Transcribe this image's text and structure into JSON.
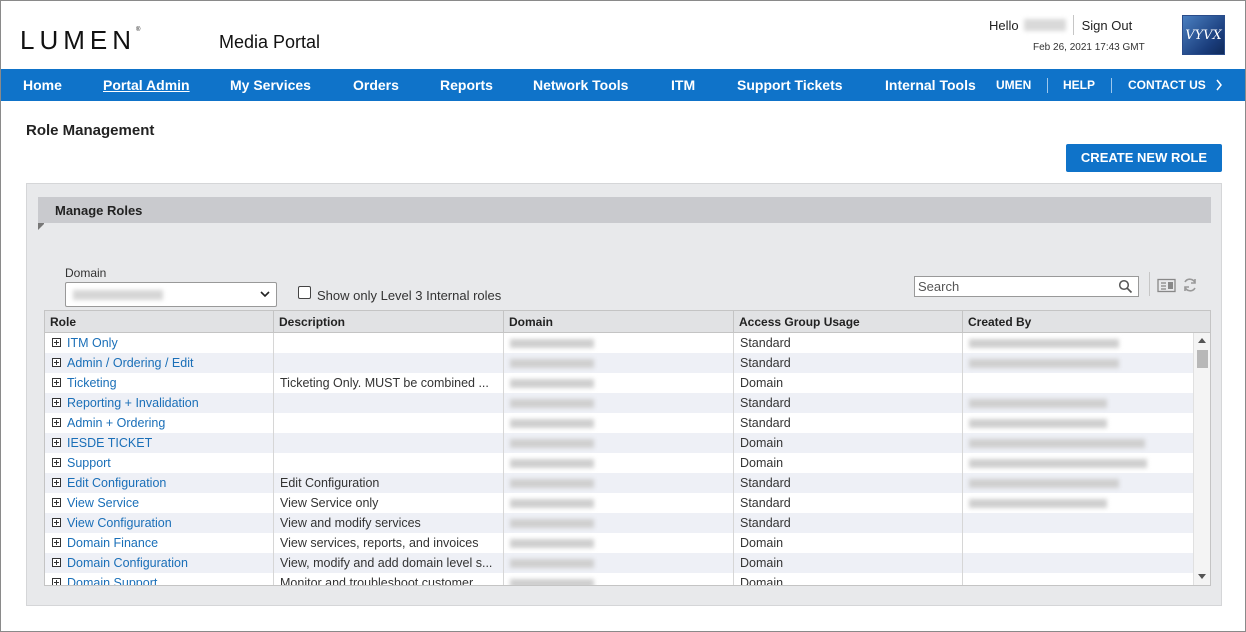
{
  "header": {
    "logo_text": "LUMEN",
    "logo_mark": "®",
    "app_title": "Media Portal",
    "greeting": "Hello",
    "sign_out": "Sign Out",
    "datetime": "Feb 26, 2021 17:43 GMT",
    "partner_logo": "VYVX"
  },
  "nav": {
    "items": [
      {
        "label": "Home"
      },
      {
        "label": "Portal Admin"
      },
      {
        "label": "My Services"
      },
      {
        "label": "Orders"
      },
      {
        "label": "Reports"
      },
      {
        "label": "Network Tools"
      },
      {
        "label": "ITM"
      },
      {
        "label": "Support Tickets"
      },
      {
        "label": "Internal Tools"
      }
    ],
    "utility": [
      {
        "label": "UMEN"
      },
      {
        "label": "HELP"
      },
      {
        "label": "CONTACT US"
      }
    ],
    "more_icon": "chevron-right-icon",
    "active_item": "Portal Admin",
    "bar_color": "#0f73c9"
  },
  "page": {
    "title": "Role Management",
    "create_button": "CREATE NEW ROLE"
  },
  "panel": {
    "title": "Manage Roles",
    "domain_label": "Domain",
    "checkbox_label": "Show only Level 3 Internal roles",
    "checkbox_checked": false,
    "search_placeholder": "Search"
  },
  "grid": {
    "columns": [
      "Role",
      "Description",
      "Domain",
      "Access Group Usage",
      "Created By"
    ],
    "rows": [
      {
        "role": "ITM Only",
        "description": "",
        "access": "Standard"
      },
      {
        "role": "Admin / Ordering / Edit",
        "description": "",
        "access": "Standard"
      },
      {
        "role": "Ticketing",
        "description": "Ticketing Only. MUST be combined ...",
        "access": "Domain"
      },
      {
        "role": "Reporting + Invalidation",
        "description": "",
        "access": "Standard"
      },
      {
        "role": "Admin + Ordering",
        "description": "",
        "access": "Standard"
      },
      {
        "role": "IESDE TICKET",
        "description": "",
        "access": "Domain"
      },
      {
        "role": "Support",
        "description": "",
        "access": "Domain"
      },
      {
        "role": "Edit Configuration",
        "description": "Edit Configuration",
        "access": "Standard"
      },
      {
        "role": "View Service",
        "description": "View Service only",
        "access": "Standard"
      },
      {
        "role": "View Configuration",
        "description": "View and modify services",
        "access": "Standard"
      },
      {
        "role": "Domain Finance",
        "description": "View services, reports, and invoices",
        "access": "Domain"
      },
      {
        "role": "Domain Configuration",
        "description": "View, modify and add domain level s...",
        "access": "Domain"
      },
      {
        "role": "Domain Support",
        "description": "Monitor and troubleshoot customer...",
        "access": "Domain"
      }
    ]
  },
  "colors": {
    "accent": "#0f73c9",
    "link": "#1a6fb8",
    "panel_bg": "#e8e9eb",
    "row_alt": "#eef0f6"
  }
}
